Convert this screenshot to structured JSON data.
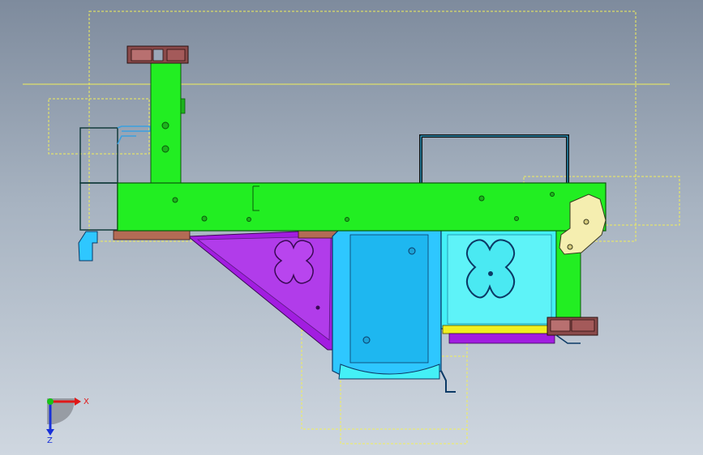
{
  "app": {
    "view": "cad-front-view"
  },
  "colors": {
    "background_top": "#7e8b9d",
    "background_bottom": "#cfd7e0",
    "bounding_box": "#f2ef5a",
    "green_frame": "#22ee22",
    "green_dark": "#1db31d",
    "purple_bracket": "#a21de0",
    "cyan_panel": "#2ec7ff",
    "cyan_light": "#44f0f6",
    "pale_plate": "#f5eeb0",
    "clip_brown": "#8a4a4a",
    "axis_x": "#e01818",
    "axis_y": "#18c418",
    "axis_z": "#1830d8"
  },
  "triad": {
    "x_label": "X",
    "z_label": "Z"
  }
}
